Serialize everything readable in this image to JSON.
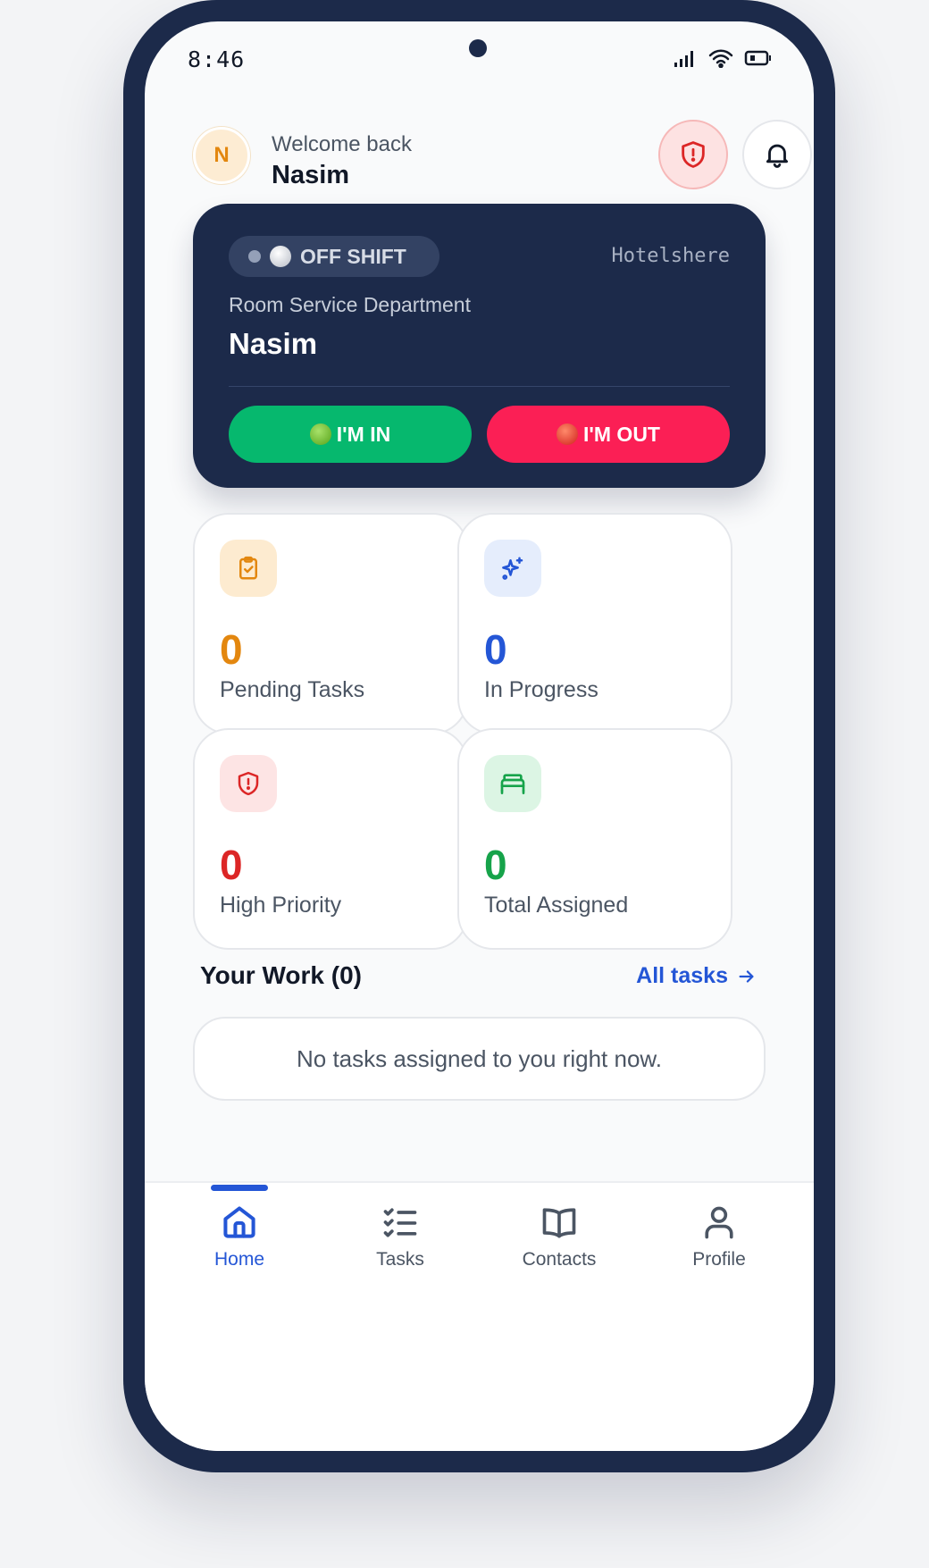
{
  "status_bar": {
    "time": "8:46"
  },
  "header": {
    "avatar_initial": "N",
    "welcome": "Welcome back",
    "user_name": "Nasim"
  },
  "shift_card": {
    "status": "OFF SHIFT",
    "hotel": "Hotelshere",
    "department": "Room Service Department",
    "name": "Nasim",
    "in_label": "I'M IN",
    "out_label": "I'M OUT"
  },
  "stats": [
    {
      "value": "0",
      "label": "Pending Tasks",
      "icon": "clipboard-check-icon",
      "color": "#e3870f",
      "bg": "#fdebd0"
    },
    {
      "value": "0",
      "label": "In Progress",
      "icon": "sparkles-icon",
      "color": "#2456d6",
      "bg": "#e5edfc"
    },
    {
      "value": "0",
      "label": "High Priority",
      "icon": "shield-alert-icon",
      "color": "#dc2626",
      "bg": "#fde4e4"
    },
    {
      "value": "0",
      "label": "Total Assigned",
      "icon": "bed-icon",
      "color": "#16a34a",
      "bg": "#dcf5e4"
    }
  ],
  "work": {
    "title": "Your Work (0)",
    "all_tasks": "All tasks",
    "empty_message": "No tasks assigned to you right now."
  },
  "nav": [
    {
      "label": "Home",
      "icon": "home-icon",
      "active": true
    },
    {
      "label": "Tasks",
      "icon": "checklist-icon",
      "active": false
    },
    {
      "label": "Contacts",
      "icon": "book-icon",
      "active": false
    },
    {
      "label": "Profile",
      "icon": "user-icon",
      "active": false
    }
  ],
  "colors": {
    "navy": "#1c2a4a",
    "accent_blue": "#2456d6",
    "green_button": "#06b86e",
    "red_button": "#fb1f55"
  }
}
